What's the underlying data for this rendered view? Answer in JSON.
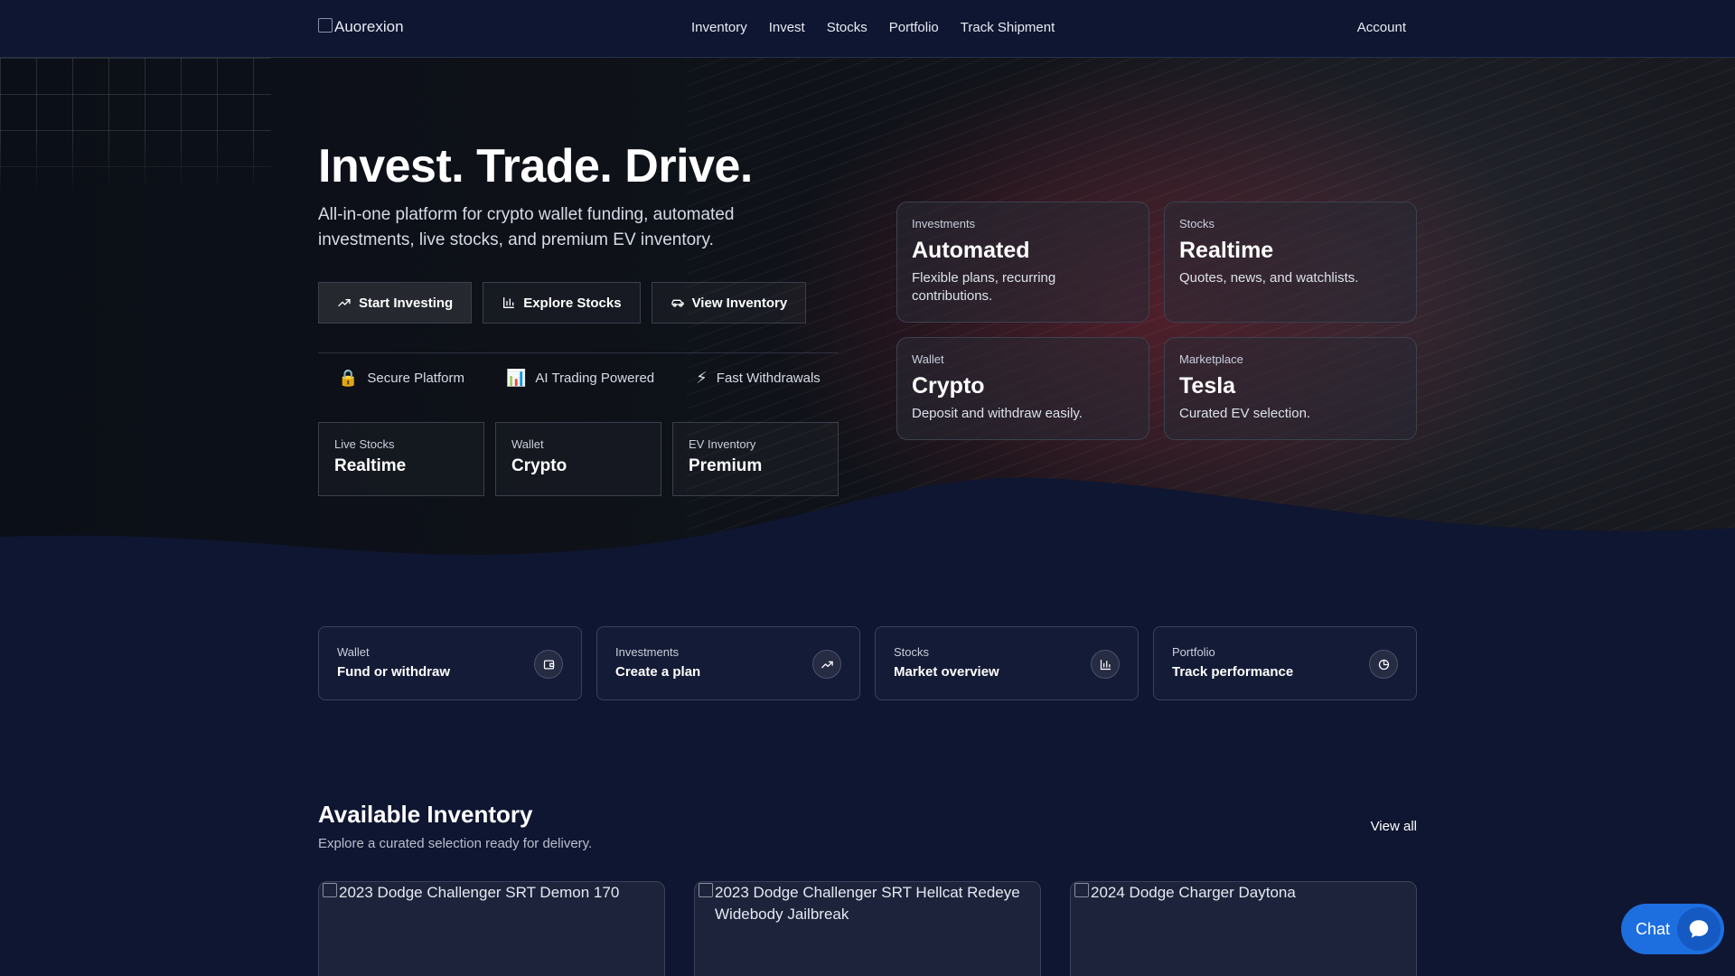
{
  "brand": {
    "logo_alt": "Auorexion"
  },
  "nav": {
    "links": [
      "Inventory",
      "Invest",
      "Stocks",
      "Portfolio",
      "Track Shipment"
    ],
    "account": "Account"
  },
  "hero": {
    "title": "Invest. Trade. Drive.",
    "subtitle": "All-in-one platform for crypto wallet funding, automated investments, live stocks, and premium EV inventory.",
    "buttons": [
      {
        "label": "Start Investing",
        "icon": "trending-up-icon"
      },
      {
        "label": "Explore Stocks",
        "icon": "bar-chart-icon"
      },
      {
        "label": "View Inventory",
        "icon": "car-icon"
      }
    ],
    "features": [
      {
        "icon": "🔒",
        "label": "Secure Platform"
      },
      {
        "icon": "📊",
        "label": "AI Trading Powered"
      },
      {
        "icon": "⚡",
        "label": "Fast Withdrawals"
      }
    ],
    "stats": [
      {
        "label": "Live Stocks",
        "value": "Realtime"
      },
      {
        "label": "Wallet",
        "value": "Crypto"
      },
      {
        "label": "EV Inventory",
        "value": "Premium"
      }
    ],
    "cards": [
      {
        "label": "Investments",
        "title": "Automated",
        "desc": "Flexible plans, recurring contributions."
      },
      {
        "label": "Stocks",
        "title": "Realtime",
        "desc": "Quotes, news, and watchlists."
      },
      {
        "label": "Wallet",
        "title": "Crypto",
        "desc": "Deposit and withdraw easily."
      },
      {
        "label": "Marketplace",
        "title": "Tesla",
        "desc": "Curated EV selection."
      }
    ]
  },
  "quick_links": [
    {
      "label": "Wallet",
      "title": "Fund or withdraw",
      "icon": "wallet-icon"
    },
    {
      "label": "Investments",
      "title": "Create a plan",
      "icon": "trending-up-icon"
    },
    {
      "label": "Stocks",
      "title": "Market overview",
      "icon": "bar-chart-icon"
    },
    {
      "label": "Portfolio",
      "title": "Track performance",
      "icon": "pie-chart-icon"
    }
  ],
  "inventory": {
    "title": "Available Inventory",
    "subtitle": "Explore a curated selection ready for delivery.",
    "view_all": "View all",
    "cars": [
      {
        "alt": "2023 Dodge Challenger SRT Demon 170"
      },
      {
        "alt": "2023 Dodge Challenger SRT Hellcat Redeye Widebody Jailbreak"
      },
      {
        "alt": "2024 Dodge Charger Daytona"
      }
    ]
  },
  "chat": {
    "label": "Chat"
  },
  "colors": {
    "background": "#0f1631",
    "accent": "#1d6fe0"
  }
}
